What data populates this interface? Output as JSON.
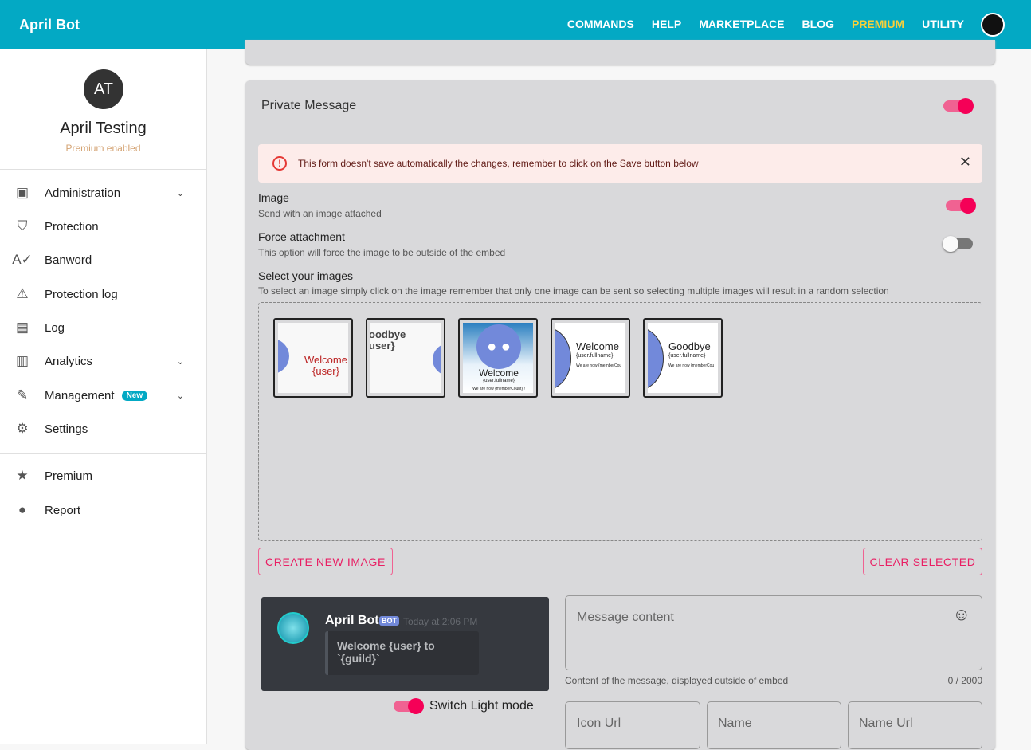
{
  "header": {
    "brand": "April Bot",
    "nav": [
      "COMMANDS",
      "HELP",
      "MARKETPLACE",
      "BLOG",
      "PREMIUM",
      "UTILITY"
    ]
  },
  "user": {
    "initials": "AT",
    "name": "April Testing",
    "status": "Premium enabled"
  },
  "sidebar": {
    "items": [
      {
        "label": "Administration",
        "icon": "badge-icon"
      },
      {
        "label": "Protection",
        "icon": "shield-icon"
      },
      {
        "label": "Banword",
        "icon": "spellcheck-icon"
      },
      {
        "label": "Protection log",
        "icon": "warning-icon"
      },
      {
        "label": "Log",
        "icon": "archive-icon"
      },
      {
        "label": "Analytics",
        "icon": "chart-icon"
      },
      {
        "label": "Management",
        "icon": "pencil-icon",
        "badge": "New"
      },
      {
        "label": "Settings",
        "icon": "gear-icon"
      },
      {
        "label": "Premium",
        "icon": "star-icon"
      },
      {
        "label": "Report",
        "icon": "report-icon"
      }
    ]
  },
  "section": {
    "title": "Private Message",
    "enabled": true
  },
  "alert": "This form doesn't save automatically the changes, remember to click on the Save button below",
  "options": [
    {
      "label": "Image",
      "desc": "Send with an image attached",
      "on": true
    },
    {
      "label": "Force attachment",
      "desc": "This option will force the image to be outside of the embed",
      "on": false
    }
  ],
  "images": {
    "label": "Select your images",
    "desc": "To select an image simply click on the image remember that only one image can be sent so selecting multiple images will result in a random selection",
    "thumbs": [
      {
        "title": "Welcome",
        "sub": "{user}"
      },
      {
        "title": "oodbye",
        "sub": "user}"
      },
      {
        "title": "Welcome",
        "sub": "{user.fullname}",
        "line": "We are now {memberCount} !"
      },
      {
        "title": "Welcome",
        "sub": "{user.fullname}",
        "line": "We are now {memberCou"
      },
      {
        "title": "Goodbye",
        "sub": "{user.fullname}",
        "line": "We are now {memberCou"
      }
    ]
  },
  "buttons": {
    "create": "CREATE NEW IMAGE",
    "clear": "CLEAR SELECTED"
  },
  "preview": {
    "name": "April Bot",
    "tag": "BOT",
    "time": "Today at 2:06 PM",
    "message": "Welcome {user} to `{guild}`",
    "switch": "Switch Light mode"
  },
  "form": {
    "message_placeholder": "Message content",
    "message_help": "Content of the message, displayed outside of embed",
    "counter": "0 / 2000",
    "icon_url": "Icon Url",
    "name": "Name",
    "name_url": "Name Url"
  }
}
